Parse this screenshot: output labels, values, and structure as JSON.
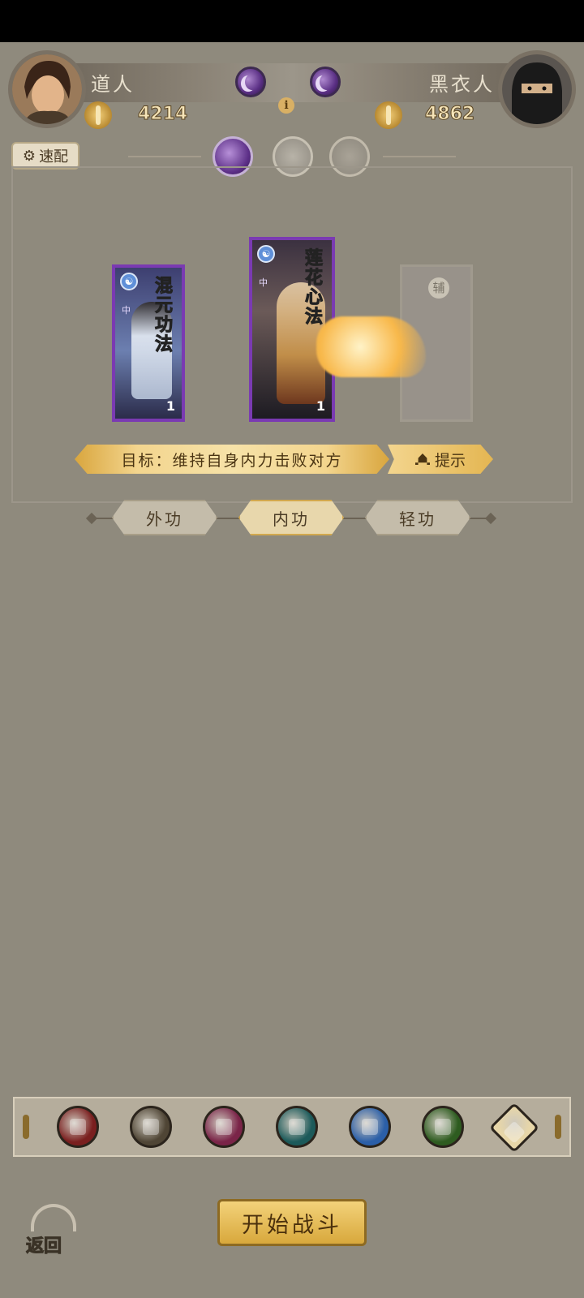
{
  "players": {
    "left": {
      "name": "道人",
      "score": "4214"
    },
    "right": {
      "name": "黑衣人",
      "score": "4862"
    }
  },
  "toolbar": {
    "quick_label": "速配"
  },
  "cards": [
    {
      "title": "混元功法",
      "count": "1",
      "type": "中"
    },
    {
      "title": "莲花心法",
      "count": "1",
      "type": "中"
    },
    {
      "title": "",
      "count": "",
      "type": "辅"
    }
  ],
  "goal": {
    "text": "目标：维持自身内力击败对方",
    "hint_label": "提示"
  },
  "tabs": [
    {
      "label": "外功",
      "active": false
    },
    {
      "label": "内功",
      "active": true
    },
    {
      "label": "轻功",
      "active": false
    }
  ],
  "skills": [
    {
      "icon": "sword-skill-icon",
      "color": "#7a1f1f"
    },
    {
      "icon": "blade-skill-icon",
      "color": "#4f4535"
    },
    {
      "icon": "fist-skill-icon",
      "color": "#7a2448"
    },
    {
      "icon": "fan-skill-icon",
      "color": "#1c5a5a"
    },
    {
      "icon": "yinyang-skill-icon",
      "color": "#2b5fa8"
    },
    {
      "icon": "wind-skill-icon",
      "color": "#2e5c20"
    },
    {
      "icon": "chevron-up-icon",
      "color": "#e7d6a8"
    }
  ],
  "actions": {
    "start_label": "开始战斗",
    "back_label": "返回"
  },
  "colors": {
    "background": "#8f8a7d",
    "gold": "#d9a63e",
    "purple": "#7a3ab2"
  }
}
